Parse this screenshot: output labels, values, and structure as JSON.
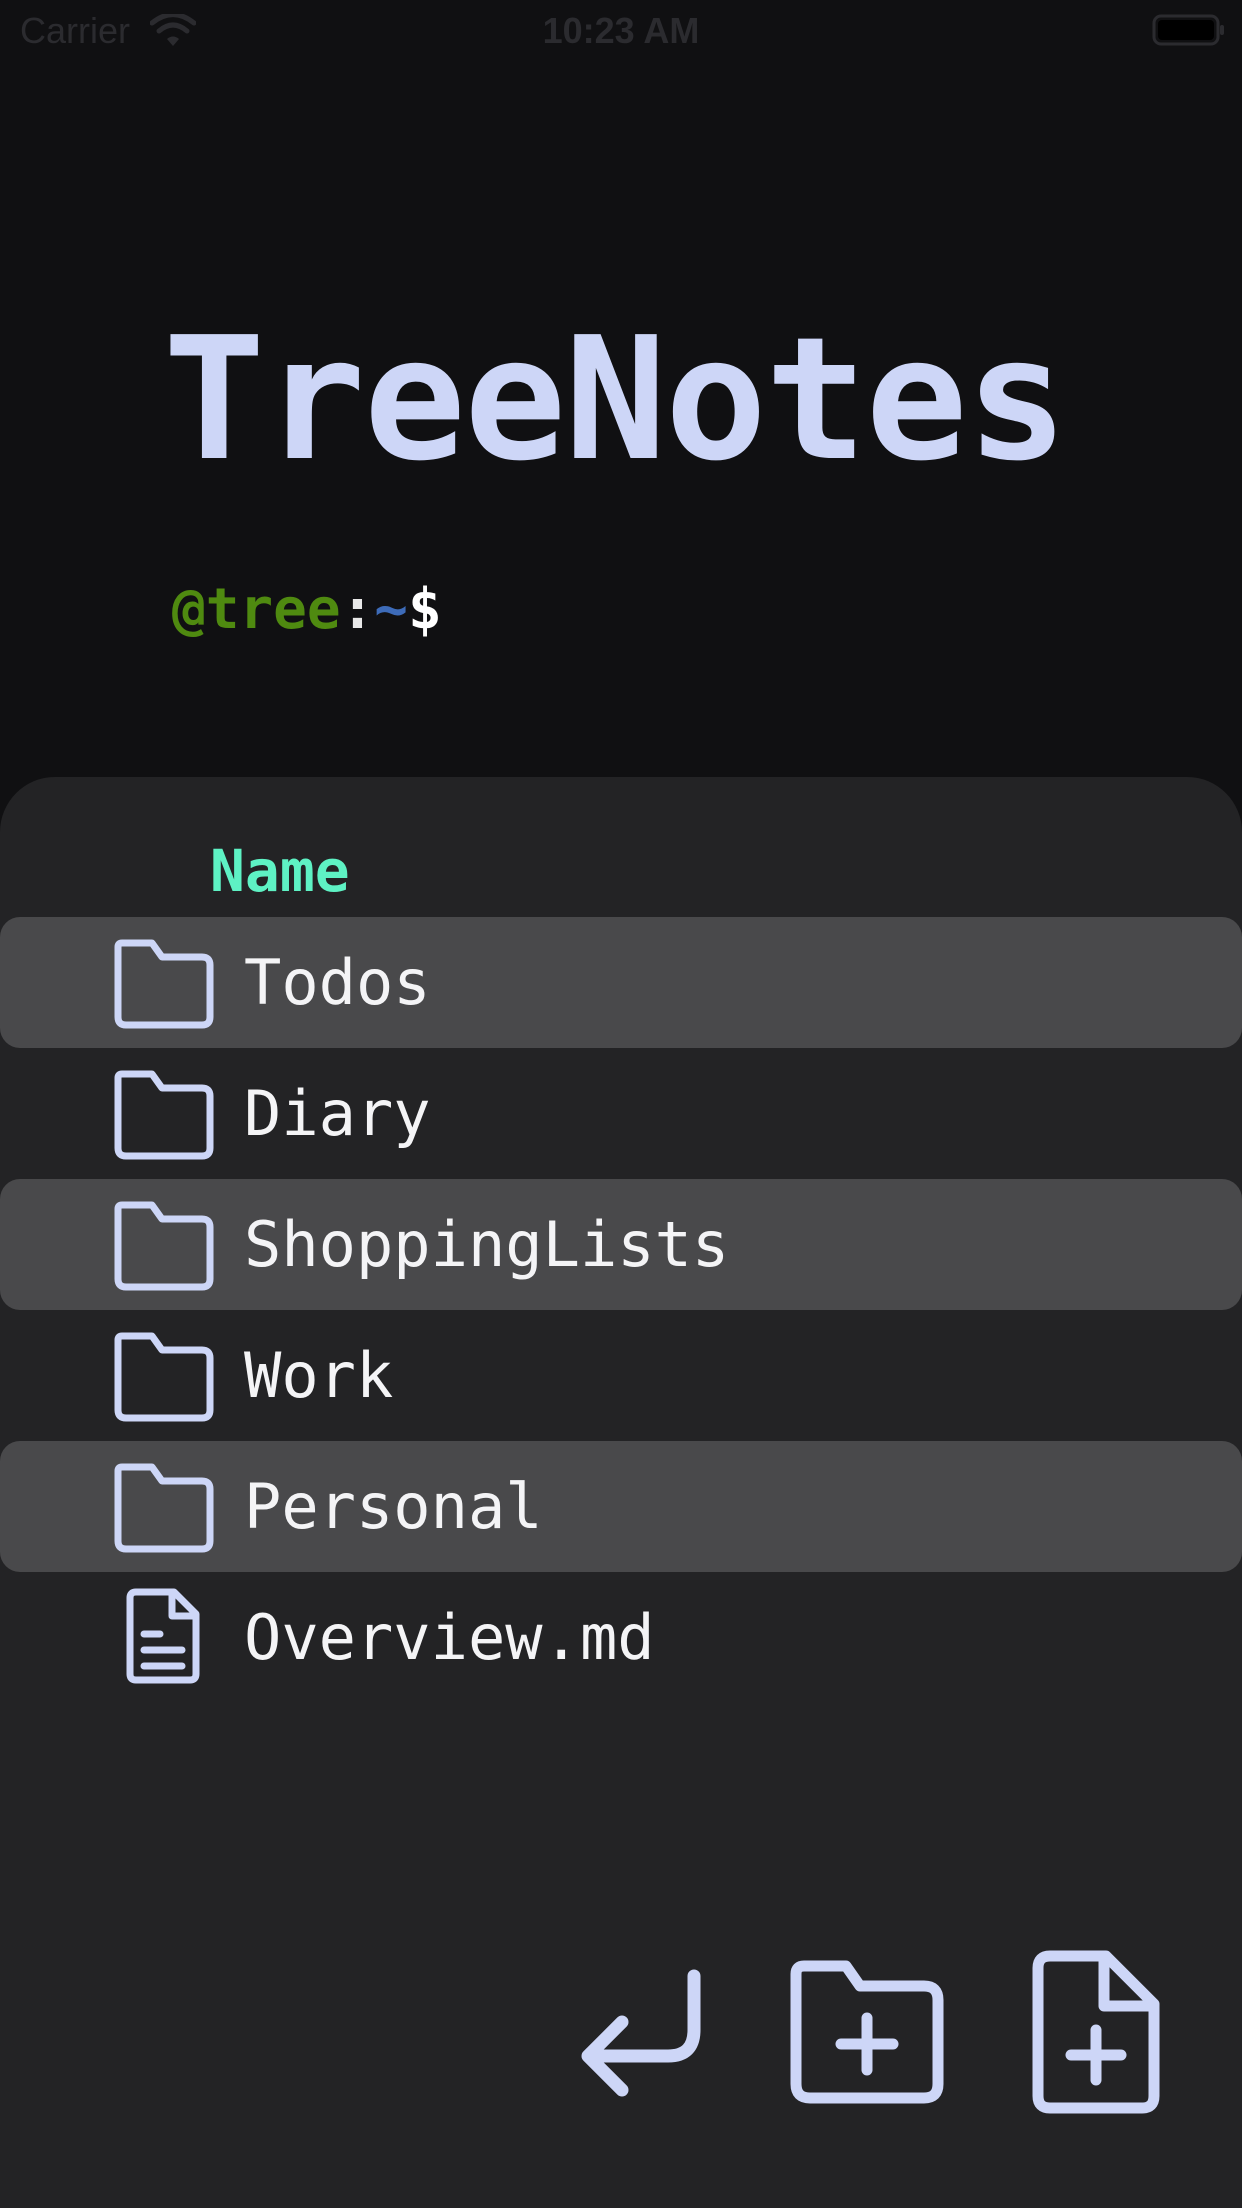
{
  "status_bar": {
    "carrier": "Carrier",
    "time": "10:23 AM"
  },
  "app": {
    "title": "TreeNotes"
  },
  "prompt": {
    "user": "@tree",
    "colon": ":",
    "path": "~",
    "symbol": "$"
  },
  "browser": {
    "column_header": "Name",
    "items": [
      {
        "name": "Todos",
        "type": "folder",
        "highlighted": true
      },
      {
        "name": "Diary",
        "type": "folder",
        "highlighted": false
      },
      {
        "name": "ShoppingLists",
        "type": "folder",
        "highlighted": true
      },
      {
        "name": "Work",
        "type": "folder",
        "highlighted": false
      },
      {
        "name": "Personal",
        "type": "folder",
        "highlighted": true
      },
      {
        "name": "Overview.md",
        "type": "file",
        "highlighted": false
      }
    ]
  },
  "toolbar": {
    "icons": [
      "return-icon",
      "new-folder-icon",
      "new-file-icon"
    ]
  },
  "colors": {
    "background": "#101012",
    "panel": "#232325",
    "row_highlight": "#49494b",
    "title": "#cdd6f7",
    "icon_stroke": "#cdd6f7",
    "header": "#5ef2c4",
    "prompt_user": "#4f8a10",
    "prompt_path": "#3d6bb8"
  }
}
